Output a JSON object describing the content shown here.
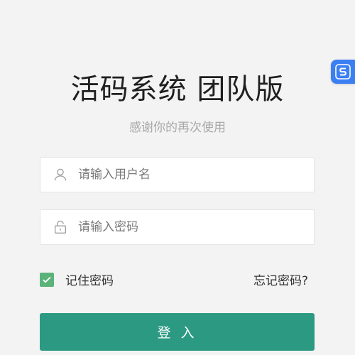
{
  "header": {
    "title": "活码系统 团队版",
    "subtitle": "感谢你的再次使用"
  },
  "form": {
    "username_placeholder": "请输入用户名",
    "username_value": "",
    "password_placeholder": "请输入密码",
    "password_value": "",
    "remember_label": "记住密码",
    "remember_checked": true,
    "forgot_label": "忘记密码?",
    "login_label": "登 入"
  },
  "icons": {
    "username": "user-icon",
    "password": "lock-icon",
    "checkbox": "check-icon",
    "floating": "s-app-icon"
  },
  "colors": {
    "accent": "#2c9a82",
    "checkbox": "#5bb37a",
    "floating_badge": "#3b7ff3",
    "background": "#f3f3f3"
  }
}
